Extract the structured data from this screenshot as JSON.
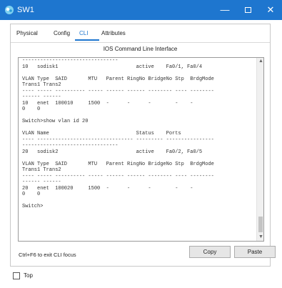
{
  "window": {
    "title": "SW1",
    "minimize_glyph": "—",
    "close_glyph": "✕",
    "accent_color": "#1e76cf"
  },
  "tabs": [
    {
      "label": "Physical"
    },
    {
      "label": "Config"
    },
    {
      "label": "CLI",
      "selected": true
    },
    {
      "label": "Attributes"
    }
  ],
  "cli_heading": "IOS Command Line Interface",
  "terminal": {
    "lines": [
      "--------------------------------",
      "10   sodisk1                          active    Fa0/1, Fa0/4",
      "",
      "VLAN Type  SAID       MTU   Parent RingNo BridgeNo Stp  BrdgMode",
      "Trans1 Trans2",
      "---- ----- ---------- ----- ------ ------ -------- ---- --------",
      "------ ------",
      "10   enet  100010     1500  -      -      -        -    -",
      "0    0",
      "",
      "Switch>show vlan id 20",
      "",
      "VLAN Name                             Status    Ports",
      "---- -------------------------------- --------- ----------------",
      "--------------------------------",
      "20   sodisk2                          active    Fa0/2, Fa0/5",
      "",
      "VLAN Type  SAID       MTU   Parent RingNo BridgeNo Stp  BrdgMode",
      "Trans1 Trans2",
      "---- ----- ---------- ----- ------ ------ -------- ---- --------",
      "------ ------",
      "20   enet  100020     1500  -      -      -        -    -",
      "0    0",
      "",
      "Switch>"
    ],
    "scroll_position": 0.92
  },
  "footer": {
    "hint": "Ctrl+F6 to exit CLI focus",
    "copy_label": "Copy",
    "paste_label": "Paste"
  },
  "bottom": {
    "top_checkbox_label": "Top",
    "top_checked": false
  }
}
